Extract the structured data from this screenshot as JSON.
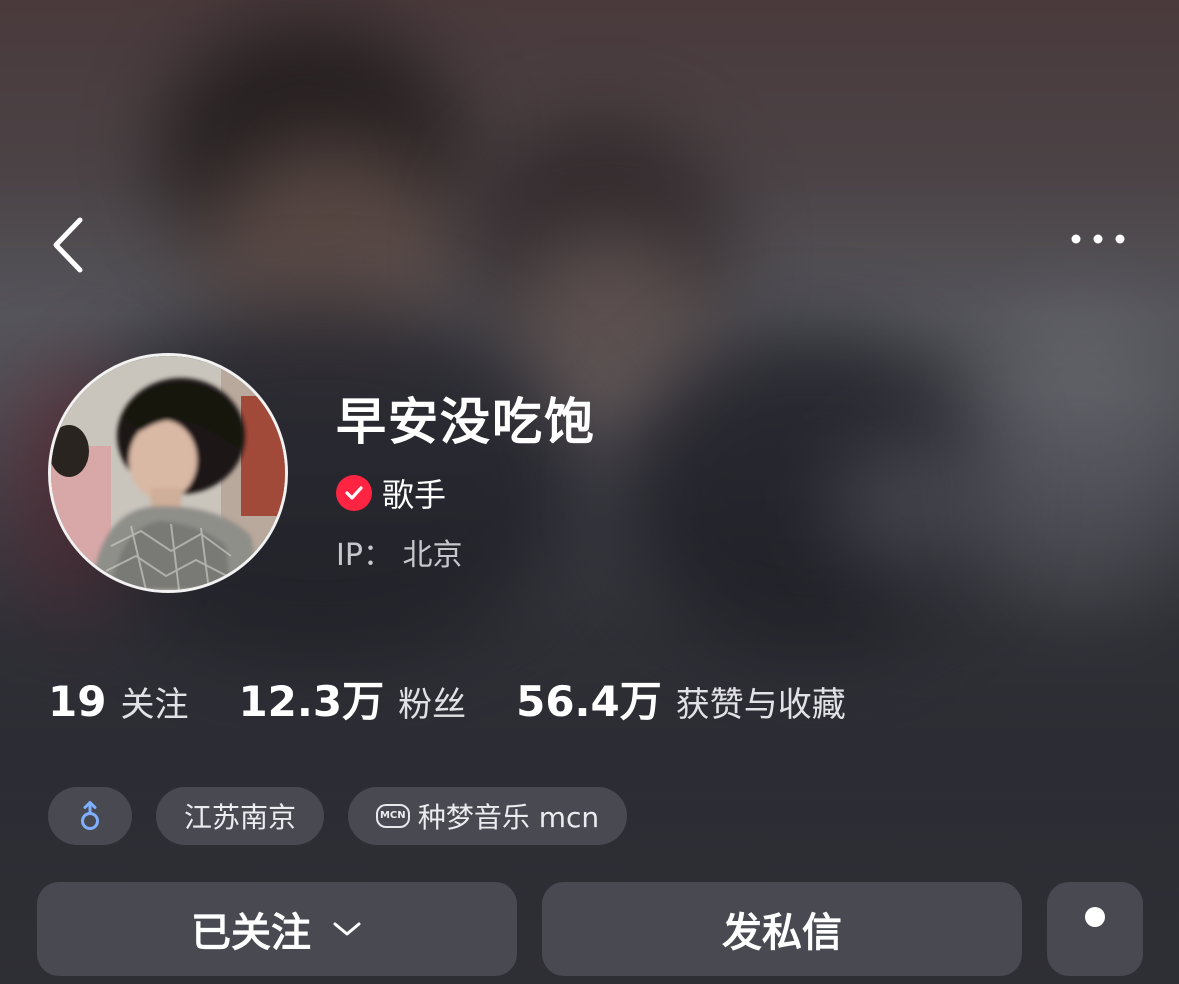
{
  "header": {
    "back_icon": "chevron-left-icon",
    "more_icon": "ellipsis-icon"
  },
  "profile": {
    "nickname": "早安没吃饱",
    "verification": {
      "icon": "verified-check-icon",
      "label": "歌手",
      "color": "#ff2442"
    },
    "ip_location": "IP： 北京"
  },
  "stats": [
    {
      "value": "19",
      "label": "关注"
    },
    {
      "value": "12.3万",
      "label": "粉丝"
    },
    {
      "value": "56.4万",
      "label": "获赞与收藏"
    }
  ],
  "tags": {
    "gender_icon": "male-icon",
    "location": "江苏南京",
    "mcn_icon_text": "MCN",
    "mcn": "种梦音乐 mcn"
  },
  "actions": {
    "followed_label": "已关注",
    "followed_icon": "chevron-down-icon",
    "message_label": "发私信",
    "more_icon": "dot-icon"
  }
}
